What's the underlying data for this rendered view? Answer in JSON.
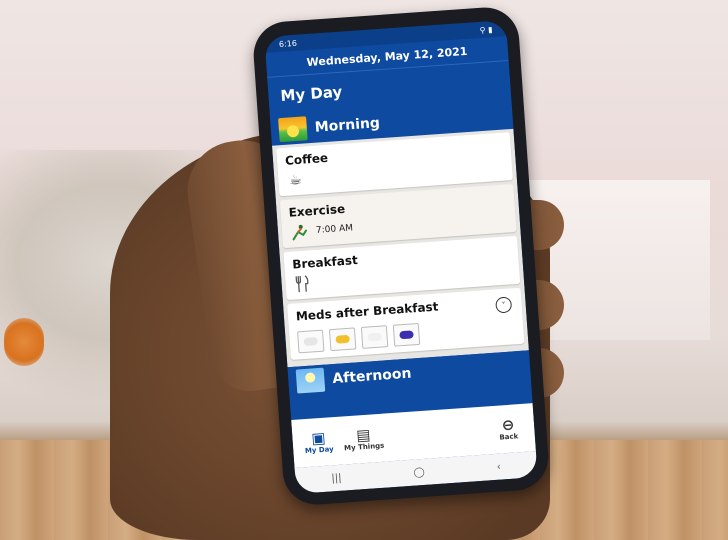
{
  "status": {
    "time": "6:16",
    "right_icons": "⚲ ▮"
  },
  "header": {
    "date": "Wednesday, May 12, 2021",
    "title": "My Day"
  },
  "sections": {
    "morning": {
      "label": "Morning",
      "icon": "sunrise-icon"
    },
    "afternoon": {
      "label": "Afternoon",
      "icon": "sun-icon"
    }
  },
  "items": {
    "coffee": {
      "title": "Coffee",
      "icon": "coffee-cup-icon"
    },
    "exercise": {
      "title": "Exercise",
      "time": "7:00 AM",
      "icon": "stretching-person-icon"
    },
    "breakfast": {
      "title": "Breakfast",
      "icon": "fork-knife-icon"
    },
    "meds": {
      "title": "Meds after Breakfast",
      "icon": "chevron-down-circle-icon",
      "pills": [
        {
          "color": "#e6e6e6"
        },
        {
          "color": "#f2c02c"
        },
        {
          "color": "#f0f0f0"
        },
        {
          "color": "#3b2fb0"
        }
      ]
    }
  },
  "bottom_nav": {
    "my_day": "My Day",
    "my_things": "My Things",
    "back": "Back"
  },
  "colors": {
    "primary": "#0e4aa0",
    "list_bg": "#e8e6e2"
  }
}
